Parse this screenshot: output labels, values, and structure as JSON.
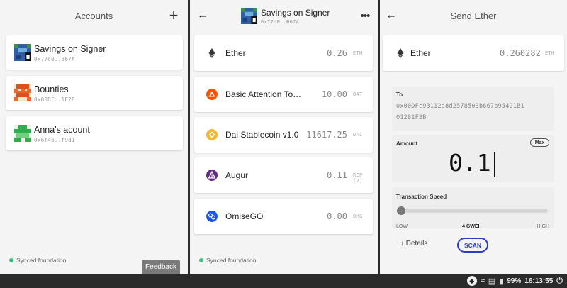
{
  "accounts_panel": {
    "title": "Accounts",
    "add_icon": "plus-icon",
    "accounts": [
      {
        "name": "Savings on Signer",
        "address": "0x77d0..B67A"
      },
      {
        "name": "Bounties",
        "address": "0x00DF..1F2B"
      },
      {
        "name": "Anna's acount",
        "address": "0x6f4b..f9d1"
      }
    ],
    "status": "Synced foundation",
    "feedback_label": "Feedback"
  },
  "account_panel": {
    "back_icon": "arrow-left-icon",
    "account_name": "Savings on Signer",
    "account_address": "0x77d0..B67A",
    "menu_icon": "more-horizontal-icon",
    "tokens": [
      {
        "name": "Ether",
        "balance": "0.26",
        "symbol": "ETH",
        "icon": "ethereum-icon"
      },
      {
        "name": "Basic Attention To…",
        "balance": "10.00",
        "symbol": "BAT",
        "icon": "bat-icon"
      },
      {
        "name": "Dai Stablecoin v1.0",
        "balance": "11617.25",
        "symbol": "DAI",
        "icon": "dai-icon"
      },
      {
        "name": "Augur",
        "balance": "0.11",
        "symbol": "REP (2)",
        "icon": "augur-icon"
      },
      {
        "name": "OmiseGO",
        "balance": "0.00",
        "symbol": "OMG",
        "icon": "omisego-icon"
      }
    ],
    "status": "Synced foundation"
  },
  "send_panel": {
    "back_icon": "arrow-left-icon",
    "title": "Send Ether",
    "token_name": "Ether",
    "token_balance": "0.260282",
    "token_symbol": "ETH",
    "to_label": "To",
    "to_address_line1": "0x00DFc93112a8d2578503b667b95491B1",
    "to_address_line2": "01281F2B",
    "amount_label": "Amount",
    "max_label": "Max",
    "amount_value": "0.1",
    "speed_label": "Transaction Speed",
    "speed_low": "LOW",
    "speed_value": "4 GWEI",
    "speed_high": "HIGH",
    "speed_position": 0.0,
    "details_label": "↓ Details",
    "scan_label": "SCAN"
  },
  "taskbar": {
    "battery": "99%",
    "time": "16:13:55"
  },
  "colors": {
    "accent_blue": "#2b3dc6",
    "synced_green": "#3fbf7f",
    "bat_orange": "#ff5000",
    "dai_yellow": "#f4b731",
    "augur_purple": "#612a84",
    "omg_blue": "#1a53f0"
  }
}
